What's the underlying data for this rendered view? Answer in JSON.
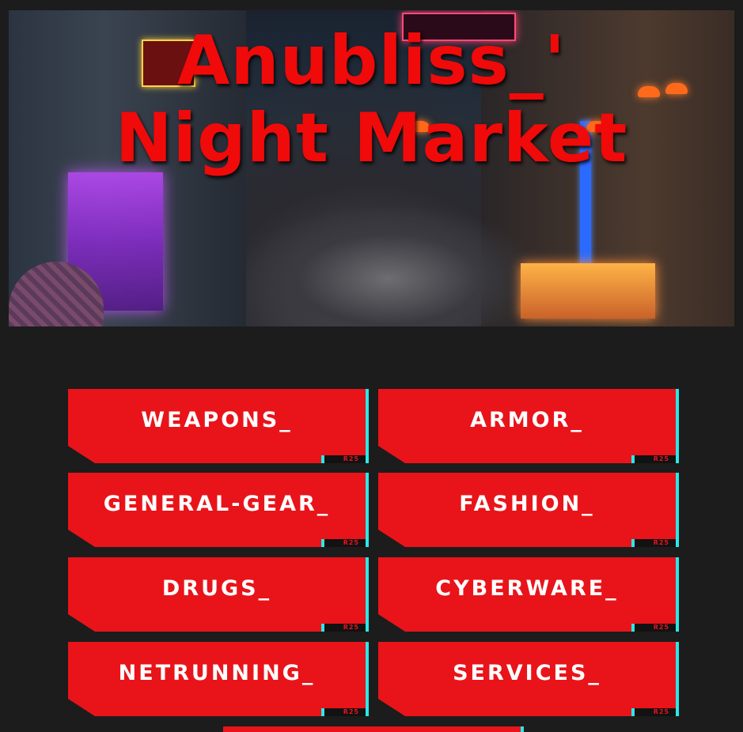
{
  "hero": {
    "title_line1": "Anubliss_'",
    "title_line2": "Night Market",
    "title_color": "#f00a0a"
  },
  "categories": [
    {
      "label": "WEAPONS_",
      "tag": "R25"
    },
    {
      "label": "ARMOR_",
      "tag": "R25"
    },
    {
      "label": "GENERAL-GEAR_",
      "tag": "R25"
    },
    {
      "label": "FASHION_",
      "tag": "R25"
    },
    {
      "label": "DRUGS_",
      "tag": "R25"
    },
    {
      "label": "CYBERWARE_",
      "tag": "R25"
    },
    {
      "label": "NETRUNNING_",
      "tag": "R25"
    },
    {
      "label": "SERVICES_",
      "tag": "R25"
    }
  ],
  "theme": {
    "button_red": "#e8141a",
    "accent_cyan": "#2ee6e6",
    "background": "#1c1c1c"
  },
  "icons": {
    "hero_image": "night-market-street-scene"
  }
}
